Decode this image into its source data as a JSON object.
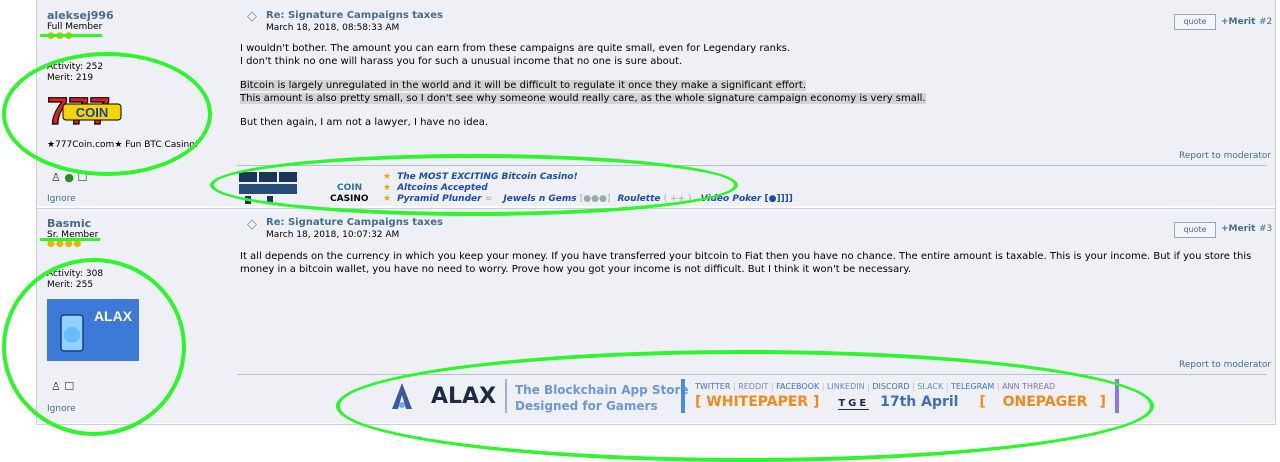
{
  "posts": [
    {
      "username": "aleksej996",
      "rank": "Full Member",
      "stars": "●●●",
      "activity": "Activity: 252",
      "merit": "Merit: 219",
      "avatar_text": "777 COIN",
      "tagline": "★777Coin.com★ Fun BTC Casino!",
      "ignore": "Ignore",
      "subject": "Re: Signature Campaigns taxes",
      "date": "March 18, 2018, 08:58:33 AM",
      "quote_label": "quote",
      "merit_label": "+Merit",
      "post_number": "#2",
      "body": [
        "I wouldn't bother. The amount you can earn from these campaigns are quite small, even for Legendary ranks.",
        "I don't think no one will harass you for such a unusual income that no one is sure about.",
        "Bitcoin is largely unregulated in the world and it will be difficult to regulate it once they make a significant effort.",
        "This amount is also pretty small, so I don't see why someone would really care, as the whole signature campaign economy is very small.",
        "But then again, I am not a lawyer, I have no idea."
      ],
      "report": "Report to moderator",
      "signature": {
        "brand_line1": "COIN",
        "brand_line2": "CASINO",
        "line1": "The MOST EXCITING Bitcoin Casino!",
        "line2": "Altcoins Accepted",
        "line3": "Pyramid Plunder",
        "line3b": "Jewels n Gems",
        "line3c": "Roulette",
        "line3d": "Video Poker"
      }
    },
    {
      "username": "Basmic",
      "rank": "Sr. Member",
      "stars": "●●●●",
      "activity": "Activity: 308",
      "merit": "Merit: 255",
      "avatar_text": "ALAX",
      "ignore": "Ignore",
      "subject": "Re: Signature Campaigns taxes",
      "date": "March 18, 2018, 10:07:32 AM",
      "quote_label": "quote",
      "merit_label": "+Merit",
      "post_number": "#3",
      "body": [
        "It all depends on the currency in which you keep your money. If you have transferred your bitcoin to Fiat then you have no chance. The entire amount is taxable. This is your income. But if you store this",
        "money in a bitcoin wallet, you have no need to worry. Prove how you got your income is not difficult. But I think it won't be necessary."
      ],
      "report": "Report to moderator",
      "signature": {
        "brand": "ALAX",
        "tagline1": "The Blockchain App Store",
        "tagline2": "Designed for Gamers",
        "links": [
          "TWITTER",
          "REDDIT",
          "FACEBOOK",
          "LINKEDIN",
          "DISCORD",
          "SLACK",
          "TELEGRAM",
          "ANN THREAD"
        ],
        "whitepaper": "WHITEPAPER",
        "tge_label": "TGE",
        "tge_date": "17th April",
        "onepager": "ONEPAGER"
      }
    }
  ],
  "colors": {
    "highlight": "#2ef52e",
    "link": "#476c8e",
    "post_bg": "#eef0f5"
  }
}
